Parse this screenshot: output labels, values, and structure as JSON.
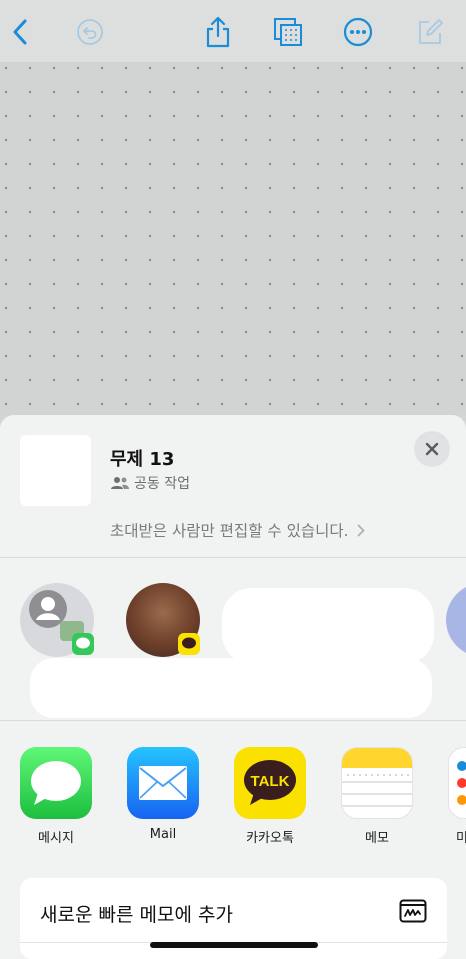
{
  "toolbar": {
    "icons": [
      "back-chevron-icon",
      "undo-icon",
      "share-icon",
      "grid-view-icon",
      "more-icon",
      "compose-icon"
    ]
  },
  "sheet": {
    "note_title": "무제 13",
    "collab_label": "공동 작업",
    "permission_text": "초대받은 사람만 편집할 수 있습니다.",
    "apps": [
      {
        "label": "메시지"
      },
      {
        "label": "Mail"
      },
      {
        "label": "카카오톡",
        "icon_text": "TALK"
      },
      {
        "label": "메모"
      },
      {
        "label": "미"
      }
    ],
    "action": {
      "label": "새로운 빠른 메모에 추가"
    }
  },
  "colors": {
    "accent": "#1a8cd8",
    "messages_green": "#34c759",
    "kakao_yellow": "#fae100",
    "mail_blue": "#1e8ef5"
  }
}
